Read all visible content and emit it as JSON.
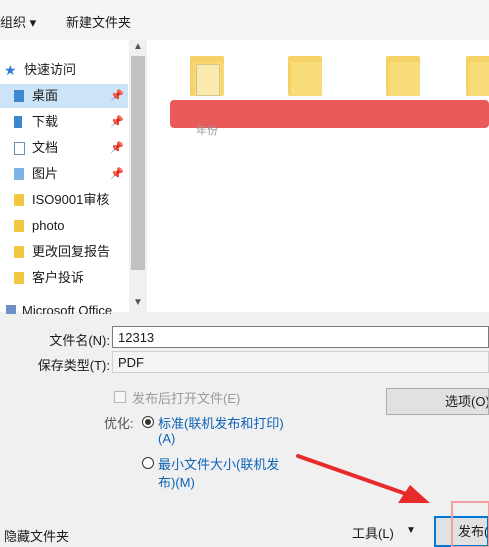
{
  "toolbar": {
    "organize": "组织 ▾",
    "new_folder": "新建文件夹"
  },
  "nav": {
    "items": [
      {
        "label": "快速访问"
      },
      {
        "label": "桌面"
      },
      {
        "label": "下载"
      },
      {
        "label": "文档"
      },
      {
        "label": "图片"
      },
      {
        "label": "ISO9001审核"
      },
      {
        "label": "photo"
      },
      {
        "label": "更改回复报告"
      },
      {
        "label": "客户投诉"
      },
      {
        "label": "Microsoft Office"
      }
    ],
    "pin_glyph": "📌"
  },
  "file_area": {
    "faint_label": "年份"
  },
  "form": {
    "filename_label": "文件名(N):",
    "filename_value": "12313",
    "filetype_label": "保存类型(T):",
    "filetype_value": "PDF"
  },
  "options": {
    "open_after_publish": "发布后打开文件(E)",
    "optimize_label": "优化:",
    "standard_line1": "标准(联机发布和打印)",
    "standard_line2": "(A)",
    "minimum_line1": "最小文件大小(联机发",
    "minimum_line2": "布)(M)",
    "options_button": "选项(O)..."
  },
  "footer": {
    "hide_folders": "隐藏文件夹",
    "tools": "工具(L)",
    "tools_arrow": "▼",
    "publish": "发布(S)"
  },
  "colors": {
    "accent": "#0078d7",
    "selection": "#cce4f7",
    "annotation": "#e82a2a"
  }
}
